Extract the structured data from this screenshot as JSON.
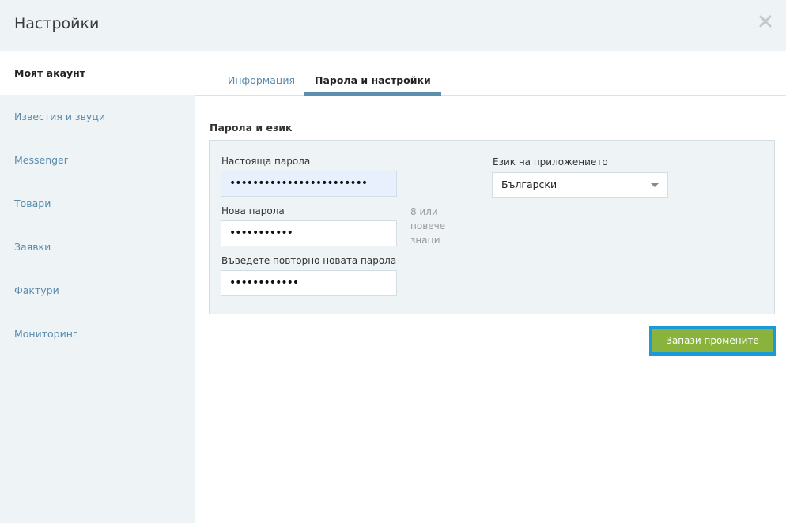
{
  "header": {
    "title": "Настройки"
  },
  "sidebar": {
    "items": [
      {
        "label": "Моят акаунт"
      },
      {
        "label": "Известия и звуци"
      },
      {
        "label": "Messenger"
      },
      {
        "label": "Товари"
      },
      {
        "label": "Заявки"
      },
      {
        "label": "Фактури"
      },
      {
        "label": "Мониторинг"
      }
    ]
  },
  "tabs": {
    "info": "Информация",
    "password": "Парола и настройки"
  },
  "section": {
    "title": "Парола и език"
  },
  "form": {
    "current_password_label": "Настояща парола",
    "current_password_value": "••••••••••••••••••••••••",
    "new_password_label": "Нова парола",
    "new_password_value": "•••••••••••",
    "new_password_hint": "8 или повече знаци",
    "repeat_password_label": "Въведете повторно новата парола",
    "repeat_password_value": "••••••••••••",
    "language_label": "Език на приложението",
    "language_value": "Български"
  },
  "actions": {
    "save_label": "Запази промените"
  },
  "colors": {
    "accent": "#5d8fad",
    "save_button": "#8ab33e",
    "focus_ring": "#1a9ad6"
  }
}
